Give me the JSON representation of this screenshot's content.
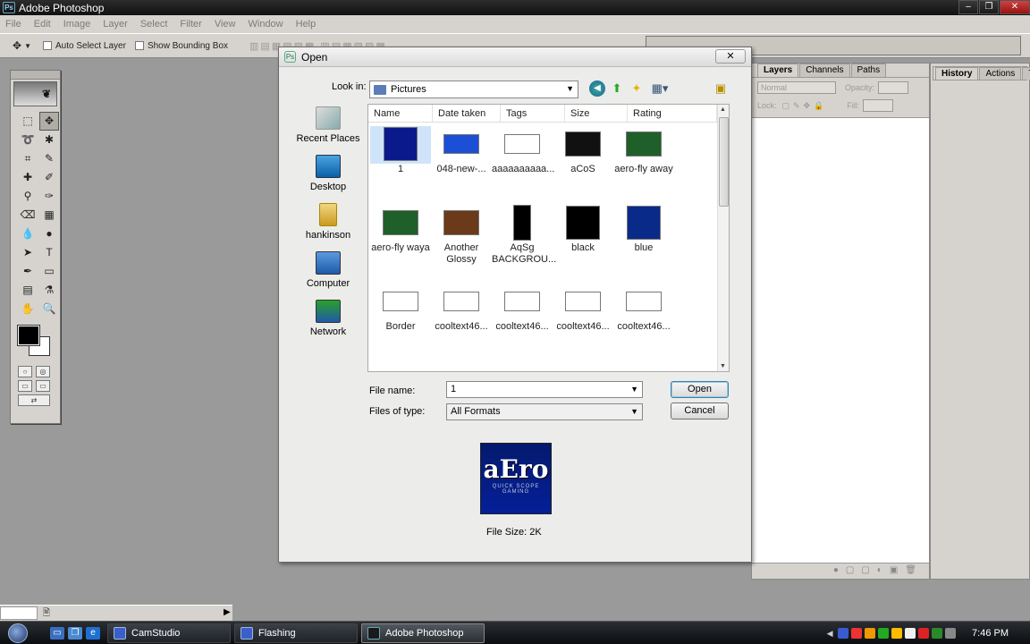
{
  "app": {
    "title": "Adobe Photoshop",
    "logo_text": "Ps"
  },
  "window_controls": {
    "minimize": "–",
    "restore": "❐",
    "close": "✕"
  },
  "menu": [
    "File",
    "Edit",
    "Image",
    "Layer",
    "Select",
    "Filter",
    "View",
    "Window",
    "Help"
  ],
  "options_bar": {
    "auto_select_label": "Auto Select Layer",
    "bounding_box_label": "Show Bounding Box"
  },
  "layers_panel": {
    "tabs": [
      "Layers",
      "Channels",
      "Paths"
    ],
    "blend_mode": "Normal",
    "opacity_label": "Opacity:",
    "lock_label": "Lock:",
    "fill_label": "Fill:"
  },
  "history_panel": {
    "tabs": [
      "History",
      "Actions",
      "Too"
    ]
  },
  "dialog": {
    "title": "Open",
    "close_label": "✕",
    "look_in_label": "Look in:",
    "look_in_value": "Pictures",
    "places": [
      "Recent Places",
      "Desktop",
      "hankinson",
      "Computer",
      "Network"
    ],
    "columns": [
      "Name",
      "Date taken",
      "Tags",
      "Size",
      "Rating"
    ],
    "files": [
      {
        "name": "1",
        "thumb": "#0a1a8a",
        "selected": true
      },
      {
        "name": "048-new-...",
        "thumb": "#1b4fd6"
      },
      {
        "name": "aaaaaaaaaa...",
        "thumb": "#ffffff"
      },
      {
        "name": "aCoS",
        "thumb": "#111111"
      },
      {
        "name": "aero-fly away",
        "thumb": "#1f5f2a"
      },
      {
        "name": "aero-fly waya",
        "thumb": "#1f5f2a"
      },
      {
        "name": "Another\nGlossy",
        "thumb": "#6a3a1a"
      },
      {
        "name": "AqSg\nBACKGROU...",
        "thumb": "#000000"
      },
      {
        "name": "black",
        "thumb": "#000000"
      },
      {
        "name": "blue",
        "thumb": "#0a2a8a"
      },
      {
        "name": "Border",
        "thumb": "#ffffff"
      },
      {
        "name": "cooltext46...",
        "thumb": "#ffffff"
      },
      {
        "name": "cooltext46...",
        "thumb": "#ffffff"
      },
      {
        "name": "cooltext46...",
        "thumb": "#ffffff"
      },
      {
        "name": "cooltext46...",
        "thumb": "#ffffff"
      }
    ],
    "file_name_label": "File name:",
    "file_name_value": "1",
    "file_type_label": "Files of type:",
    "file_type_value": "All Formats",
    "open_button": "Open",
    "cancel_button": "Cancel",
    "preview_main": "aEro",
    "preview_sub": "QUICK SCOPE GAMING",
    "file_size": "File Size: 2K"
  },
  "taskbar": {
    "tasks": [
      "CamStudio",
      "Flashing",
      "Adobe Photoshop"
    ],
    "active_task": "Adobe Photoshop",
    "clock": "7:46 PM"
  }
}
